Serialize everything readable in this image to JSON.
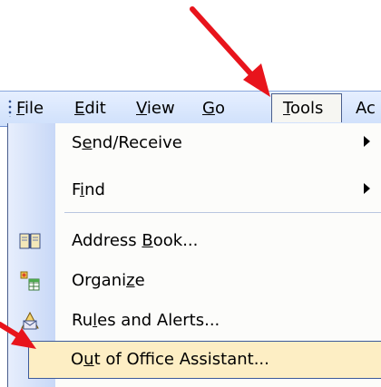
{
  "menubar": {
    "items": [
      {
        "pre": "",
        "ul": "F",
        "post": "ile"
      },
      {
        "pre": "",
        "ul": "E",
        "post": "dit"
      },
      {
        "pre": "",
        "ul": "V",
        "post": "iew"
      },
      {
        "pre": "",
        "ul": "G",
        "post": "o"
      },
      {
        "pre": "",
        "ul": "T",
        "post": "ools"
      },
      {
        "pre": "",
        "ul": "",
        "post": "Ac"
      }
    ]
  },
  "tools_menu": {
    "items": [
      {
        "pre": "S",
        "ul": "e",
        "post": "nd/Receive",
        "has_submenu": true
      },
      {
        "pre": "F",
        "ul": "i",
        "post": "nd",
        "has_submenu": true
      },
      {
        "pre": "Address ",
        "ul": "B",
        "post": "ook...",
        "icon": "address-book-icon"
      },
      {
        "pre": "Organi",
        "ul": "z",
        "post": "e",
        "icon": "organize-icon"
      },
      {
        "pre": "Ru",
        "ul": "l",
        "post": "es and Alerts...",
        "icon": "rules-alerts-icon"
      },
      {
        "pre": "O",
        "ul": "u",
        "post": "t of Office Assistant...",
        "highlighted": true
      }
    ]
  },
  "colors": {
    "annotation_arrow": "#e8141c",
    "highlight_fill": "#fdeec4",
    "menubar_fill": "#d6e4fc"
  }
}
